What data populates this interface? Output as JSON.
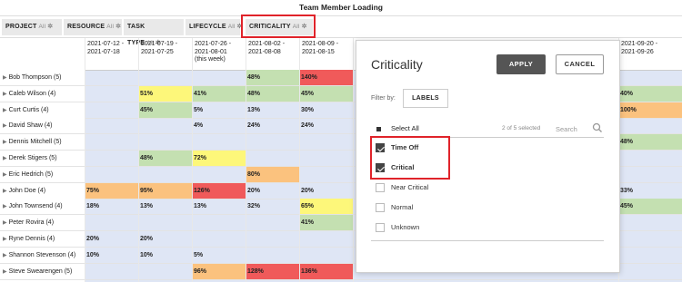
{
  "title": "Team Member Loading",
  "filters": [
    {
      "label": "PROJECT",
      "all": "All"
    },
    {
      "label": "RESOURCE",
      "all": "All"
    },
    {
      "label": "TASK TYPE",
      "all": "All"
    },
    {
      "label": "LIFECYCLE",
      "all": "All"
    },
    {
      "label": "CRITICALITY",
      "all": "All"
    }
  ],
  "columns": [
    {
      "l1": "2021-07-12 -",
      "l2": "2021-07-18",
      "l3": ""
    },
    {
      "l1": "2021-07-19 -",
      "l2": "2021-07-25",
      "l3": ""
    },
    {
      "l1": "2021-07-26 -",
      "l2": "2021-08-01",
      "l3": "(this week)"
    },
    {
      "l1": "2021-08-02 -",
      "l2": "2021-08-08",
      "l3": ""
    },
    {
      "l1": "2021-08-09 -",
      "l2": "2021-08-15",
      "l3": ""
    },
    {
      "l1": "2021-09-20 -",
      "l2": "2021-09-26",
      "l3": ""
    }
  ],
  "rows": [
    {
      "name": "Bob Thompson (5)",
      "cells": [
        "",
        "",
        "",
        "48%",
        "140%",
        ""
      ]
    },
    {
      "name": "Caleb Wilson (4)",
      "cells": [
        "",
        "51%",
        "41%",
        "48%",
        "45%",
        "40%"
      ]
    },
    {
      "name": "Curt Curtis (4)",
      "cells": [
        "",
        "45%",
        "5%",
        "13%",
        "30%",
        "100%"
      ]
    },
    {
      "name": "David Shaw (4)",
      "cells": [
        "",
        "",
        "4%",
        "24%",
        "24%",
        ""
      ]
    },
    {
      "name": "Dennis Mitchell (5)",
      "cells": [
        "",
        "",
        "",
        "",
        "",
        "48%"
      ]
    },
    {
      "name": "Derek Stigers (5)",
      "cells": [
        "",
        "48%",
        "72%",
        "",
        "",
        ""
      ]
    },
    {
      "name": "Eric Hedrich (5)",
      "cells": [
        "",
        "",
        "",
        "80%",
        "",
        ""
      ]
    },
    {
      "name": "John Doe (4)",
      "cells": [
        "75%",
        "95%",
        "126%",
        "20%",
        "20%",
        "33%"
      ]
    },
    {
      "name": "John Townsend (4)",
      "cells": [
        "18%",
        "13%",
        "13%",
        "32%",
        "65%",
        "45%"
      ]
    },
    {
      "name": "Peter Rovira (4)",
      "cells": [
        "",
        "",
        "",
        "",
        "41%",
        ""
      ]
    },
    {
      "name": "Ryne Dennis (4)",
      "cells": [
        "20%",
        "20%",
        "",
        "",
        "",
        ""
      ]
    },
    {
      "name": "Shannon Stevenson (4)",
      "cells": [
        "10%",
        "10%",
        "5%",
        "",
        "",
        ""
      ]
    },
    {
      "name": "Steve Swearengen (5)",
      "cells": [
        "",
        "",
        "96%",
        "128%",
        "136%",
        ""
      ]
    }
  ],
  "popup": {
    "title": "Criticality",
    "apply": "APPLY",
    "cancel": "CANCEL",
    "filter_by": "Filter by:",
    "labels_btn": "LABELS",
    "select_all": "Select All",
    "selected_count": "2 of 5 selected",
    "search_placeholder": "Search",
    "options": [
      {
        "label": "Time Off",
        "checked": true
      },
      {
        "label": "Critical",
        "checked": true
      },
      {
        "label": "Near Critical",
        "checked": false
      },
      {
        "label": "Normal",
        "checked": false
      },
      {
        "label": "Unknown",
        "checked": false
      }
    ]
  },
  "colors": {
    "red": "#f05a5a",
    "orange": "#fbc27e",
    "yellow": "#fdf77a",
    "green": "#c4e0b1",
    "empty_blue": "#dfe6f5",
    "highlight": "#e0232a"
  }
}
